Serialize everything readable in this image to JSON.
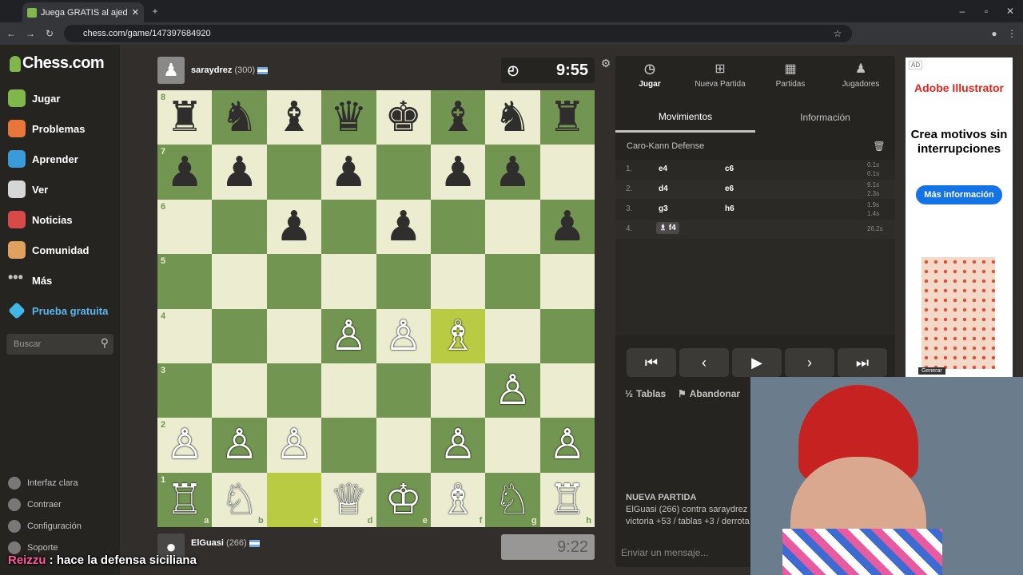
{
  "browser": {
    "tab_title": "Juega GRATIS al ajedrez on",
    "url": "chess.com/game/147397684920"
  },
  "nav": {
    "logo": "Chess.com",
    "items": [
      "Jugar",
      "Problemas",
      "Aprender",
      "Ver",
      "Noticias",
      "Comunidad",
      "Más",
      "Prueba gratuita"
    ],
    "search_placeholder": "Buscar",
    "bottom": [
      "Interfaz clara",
      "Contraer",
      "Configuración",
      "Soporte"
    ]
  },
  "top_player": {
    "name": "saraydrez",
    "rating": "(300)",
    "clock": "9:55"
  },
  "bottom_player": {
    "name": "ElGuasi",
    "rating": "(266)",
    "clock": "9:22"
  },
  "board": {
    "files": [
      "a",
      "b",
      "c",
      "d",
      "e",
      "f",
      "g",
      "h"
    ],
    "ranks": [
      "8",
      "7",
      "6",
      "5",
      "4",
      "3",
      "2",
      "1"
    ],
    "rows": [
      [
        "♜",
        "♞",
        "♝",
        "♛",
        "♚",
        "♝",
        "♞",
        "♜"
      ],
      [
        "♟",
        "♟",
        "",
        "♟",
        "",
        "♟",
        "♟",
        ""
      ],
      [
        "",
        "",
        "♟",
        "",
        "♟",
        "",
        "",
        "♟"
      ],
      [
        "",
        "",
        "",
        "",
        "",
        "",
        "",
        ""
      ],
      [
        "",
        "",
        "",
        "♙",
        "♙",
        "♗",
        "",
        ""
      ],
      [
        "",
        "",
        "",
        "",
        "",
        "",
        "♙",
        ""
      ],
      [
        "♙",
        "♙",
        "♙",
        "",
        "",
        "♙",
        "",
        "♙"
      ],
      [
        "♖",
        "♘",
        "",
        "♕",
        "♔",
        "♗",
        "♘",
        "♖"
      ]
    ]
  },
  "panel": {
    "tabs": [
      "Jugar",
      "Nueva Partida",
      "Partidas",
      "Jugadores"
    ],
    "subtabs": [
      "Movimientos",
      "Información"
    ],
    "opening": "Caro-Kann Defense",
    "moves": [
      {
        "n": "1.",
        "w": "e4",
        "b": "c6",
        "t1": "0.1s",
        "t2": "0.1s"
      },
      {
        "n": "2.",
        "w": "d4",
        "b": "e6",
        "t1": "9.1s",
        "t2": "2.3s"
      },
      {
        "n": "3.",
        "w": "g3",
        "b": "h6",
        "t1": "1.9s",
        "t2": "1.4s"
      },
      {
        "n": "4.",
        "w": "f4",
        "b": "",
        "t1": "26.2s",
        "t2": ""
      }
    ],
    "draw": "Tablas",
    "resign": "Abandonar",
    "new_game_title": "NUEVA PARTIDA",
    "new_game_line1": "ElGuasi (266) contra saraydrez (",
    "new_game_line2": "victoria +53 / tablas +3 / derrota",
    "chat_placeholder": "Enviar un mensaje..."
  },
  "ad": {
    "tag": "AD",
    "brand": "Adobe Illustrator",
    "headline": "Crea motivos sin interrupciones",
    "cta": "Más información",
    "gen": "Generar"
  },
  "caption": {
    "user": "Reizzu",
    "text": " : hace la defensa siciliana"
  }
}
